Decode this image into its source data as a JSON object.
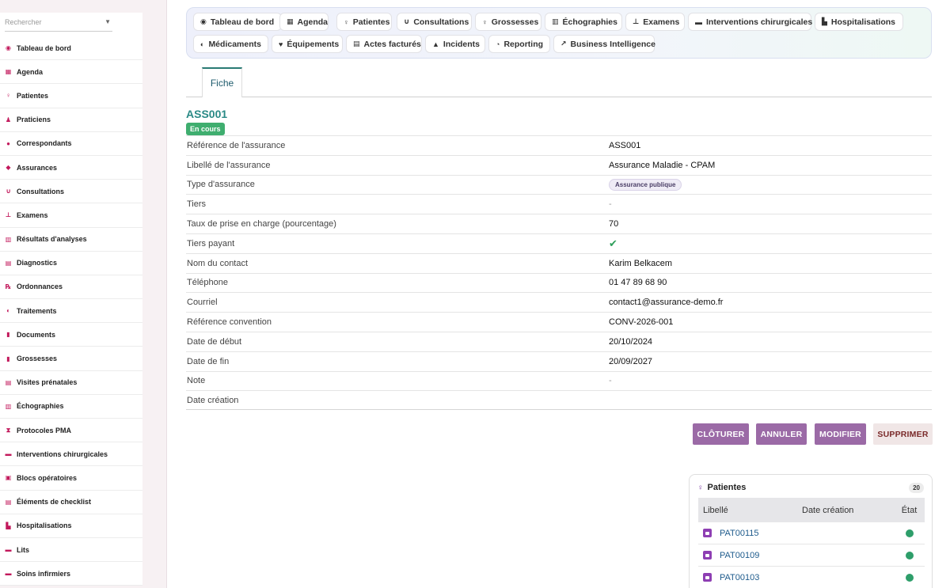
{
  "sidebar": {
    "search_placeholder": "Rechercher",
    "items": [
      {
        "label": "Tableau de bord",
        "icon": "dashboard-icon",
        "glyph": "◉"
      },
      {
        "label": "Agenda",
        "icon": "calendar-icon",
        "glyph": "▦"
      },
      {
        "label": "Patientes",
        "icon": "female-icon",
        "glyph": "♀"
      },
      {
        "label": "Praticiens",
        "icon": "doctor-icon",
        "glyph": "♟"
      },
      {
        "label": "Correspondants",
        "icon": "user-icon",
        "glyph": "●"
      },
      {
        "label": "Assurances",
        "icon": "shield-icon",
        "glyph": "◆"
      },
      {
        "label": "Consultations",
        "icon": "stethoscope-icon",
        "glyph": "∪"
      },
      {
        "label": "Examens",
        "icon": "microscope-icon",
        "glyph": "⊥"
      },
      {
        "label": "Résultats d'analyses",
        "icon": "flask-icon",
        "glyph": "▥"
      },
      {
        "label": "Diagnostics",
        "icon": "clipboard-icon",
        "glyph": "▤"
      },
      {
        "label": "Ordonnances",
        "icon": "prescription-icon",
        "glyph": "℞"
      },
      {
        "label": "Traitements",
        "icon": "pills-icon",
        "glyph": "◐"
      },
      {
        "label": "Documents",
        "icon": "file-icon",
        "glyph": "▮"
      },
      {
        "label": "Grossesses",
        "icon": "pregnancy-icon",
        "glyph": "▮"
      },
      {
        "label": "Visites prénatales",
        "icon": "clipboard-check-icon",
        "glyph": "▤"
      },
      {
        "label": "Échographies",
        "icon": "ultrasound-icon",
        "glyph": "▥"
      },
      {
        "label": "Protocoles PMA",
        "icon": "hourglass-icon",
        "glyph": "⧗"
      },
      {
        "label": "Interventions chirurgicales",
        "icon": "procedure-bed-icon",
        "glyph": "▬"
      },
      {
        "label": "Blocs opératoires",
        "icon": "operating-room-icon",
        "glyph": "▣"
      },
      {
        "label": "Éléments de checklist",
        "icon": "checklist-icon",
        "glyph": "▤"
      },
      {
        "label": "Hospitalisations",
        "icon": "hospital-icon",
        "glyph": "▙"
      },
      {
        "label": "Lits",
        "icon": "bed-icon",
        "glyph": "▬"
      },
      {
        "label": "Soins infirmiers",
        "icon": "nurse-icon",
        "glyph": "▬"
      }
    ]
  },
  "modules": [
    {
      "label": "Tableau de bord",
      "icon": "dashboard-icon",
      "glyph": "◉"
    },
    {
      "label": "Agenda",
      "icon": "calendar-icon",
      "glyph": "▦"
    },
    {
      "label": "Patientes",
      "icon": "female-icon",
      "glyph": "♀"
    },
    {
      "label": "Consultations",
      "icon": "stethoscope-icon",
      "glyph": "∪"
    },
    {
      "label": "Grossesses",
      "icon": "pregnancy-icon",
      "glyph": "♀"
    },
    {
      "label": "Échographies",
      "icon": "ultrasound-icon",
      "glyph": "▥"
    },
    {
      "label": "Examens",
      "icon": "microscope-icon",
      "glyph": "⊥"
    },
    {
      "label": "Interventions chirurgicales",
      "icon": "procedure-bed-icon",
      "glyph": "▬"
    },
    {
      "label": "Hospitalisations",
      "icon": "hospital-icon",
      "glyph": "▙"
    },
    {
      "label": "Médicaments",
      "icon": "pills-icon",
      "glyph": "◐"
    },
    {
      "label": "Équipements",
      "icon": "heart-pulse-icon",
      "glyph": "♥"
    },
    {
      "label": "Actes facturés",
      "icon": "invoice-icon",
      "glyph": "▤"
    },
    {
      "label": "Incidents",
      "icon": "warning-icon",
      "glyph": "▲"
    },
    {
      "label": "Reporting",
      "icon": "pie-chart-icon",
      "glyph": "◔"
    },
    {
      "label": "Business Intelligence",
      "icon": "line-chart-icon",
      "glyph": "↗"
    }
  ],
  "tab": {
    "label": "Fiche"
  },
  "record": {
    "title": "ASS001",
    "status": "En cours",
    "fields": [
      {
        "label": "Référence de l'assurance",
        "value": "ASS001",
        "kind": "text"
      },
      {
        "label": "Libellé de l'assurance",
        "value": "Assurance Maladie - CPAM",
        "kind": "text"
      },
      {
        "label": "Type d'assurance",
        "value": "Assurance publique",
        "kind": "pill"
      },
      {
        "label": "Tiers",
        "value": "-",
        "kind": "dash"
      },
      {
        "label": "Taux de prise en charge (pourcentage)",
        "value": "70",
        "kind": "text"
      },
      {
        "label": "Tiers payant",
        "value": "✔",
        "kind": "check"
      },
      {
        "label": "Nom du contact",
        "value": "Karim Belkacem",
        "kind": "text"
      },
      {
        "label": "Téléphone",
        "value": "01 47 89 68 90",
        "kind": "text"
      },
      {
        "label": "Courriel",
        "value": "contact1@assurance-demo.fr",
        "kind": "text"
      },
      {
        "label": "Référence convention",
        "value": "CONV-2026-001",
        "kind": "text"
      },
      {
        "label": "Date de début",
        "value": "20/10/2024",
        "kind": "text"
      },
      {
        "label": "Date de fin",
        "value": "20/09/2027",
        "kind": "text"
      },
      {
        "label": "Note",
        "value": "-",
        "kind": "dash"
      },
      {
        "label": "Date création",
        "value": "",
        "kind": "text"
      }
    ]
  },
  "actions": {
    "close": "CLÔTURER",
    "cancel": "ANNULER",
    "edit": "MODIFIER",
    "delete": "SUPPRIMER"
  },
  "patients_panel": {
    "title": "Patientes",
    "count": "20",
    "columns": [
      "Libellé",
      "Date création",
      "État"
    ],
    "rows": [
      {
        "label": "PAT00115",
        "date": "",
        "state_color": "#2e9e6a"
      },
      {
        "label": "PAT00109",
        "date": "",
        "state_color": "#2e9e6a"
      },
      {
        "label": "PAT00103",
        "date": "",
        "state_color": "#2e9e6a"
      }
    ]
  },
  "colors": {
    "accent_teal": "#2a8a86",
    "status_green": "#3fae6f",
    "action_purple": "#9b6aa6",
    "nav_icon": "#c2185b"
  }
}
